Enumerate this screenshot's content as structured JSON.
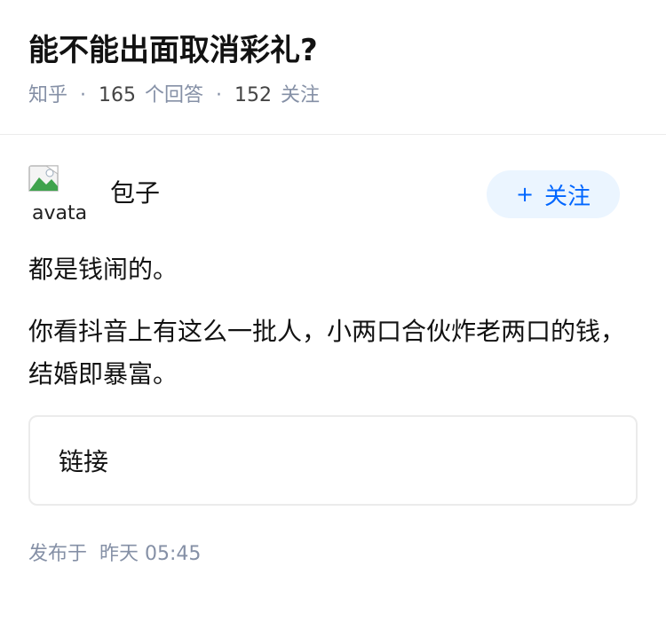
{
  "question": {
    "title": "能不能出面取消彩礼?",
    "source": "知乎",
    "separator": "·",
    "answer_count": "165",
    "answer_label": "个回答",
    "follower_count": "152",
    "follower_label": "关注"
  },
  "author": {
    "avatar_alt": "avatar",
    "avatar_icon": "broken-image-icon",
    "name": "包子",
    "follow_plus": "+",
    "follow_label": "关注"
  },
  "content": {
    "paragraphs": [
      "都是钱闹的。",
      "你看抖音上有这么一批人，小两口合伙炸老两口的钱，结婚即暴富。"
    ],
    "link_label": "链接"
  },
  "publish": {
    "label": "发布于",
    "time": "昨天 05:45"
  },
  "colors": {
    "accent": "#0066ff",
    "follow_bg": "#ebf5ff",
    "meta_gray": "#8590a6"
  }
}
